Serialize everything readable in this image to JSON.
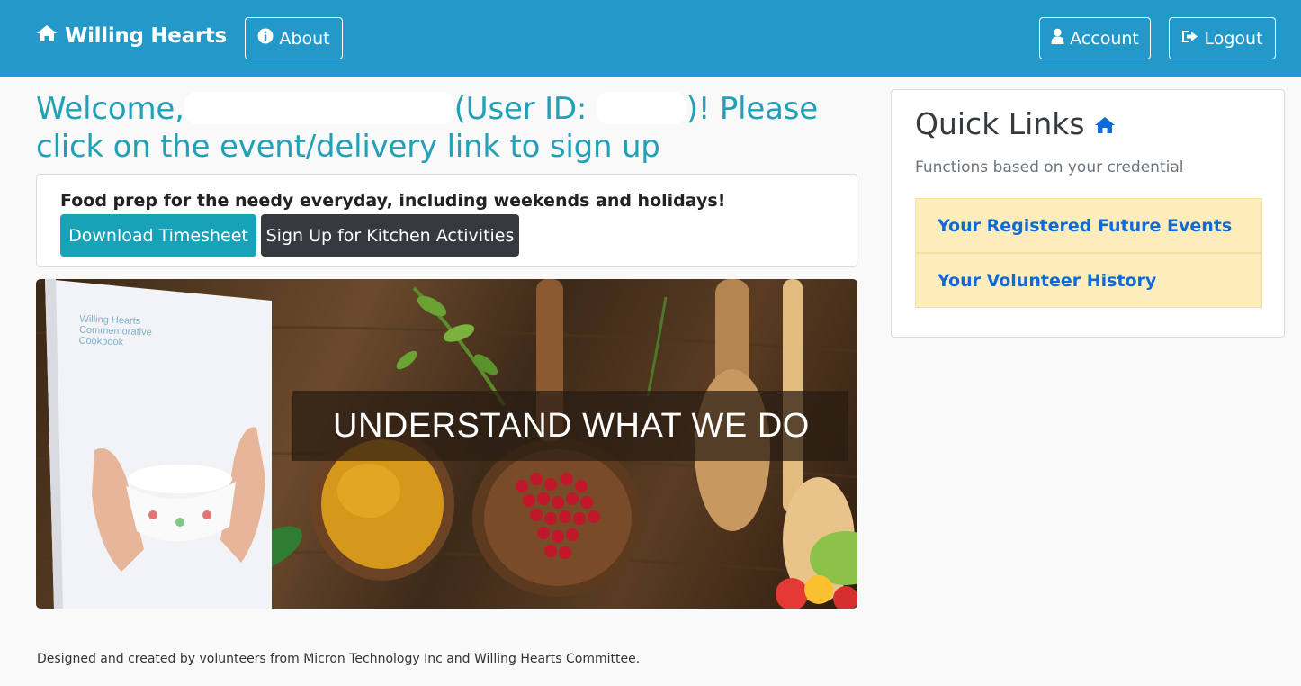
{
  "navbar": {
    "brand": "Willing Hearts",
    "about": "About",
    "account": "Account",
    "logout": "Logout",
    "colors": {
      "background": "#2399c9",
      "text": "#ffffff"
    }
  },
  "welcome": {
    "prefix": "Welcome,",
    "user_id_prefix": "(User ID:",
    "suffix": ")! Please click on the event/delivery link to sign up"
  },
  "event": {
    "title": "Food prep for the needy everyday, including weekends and holidays!",
    "download_label": "Download Timesheet",
    "signup_label": "Sign Up for Kitchen Activities"
  },
  "banner": {
    "caption": "UNDERSTAND WHAT WE DO",
    "book_title": "Willing Hearts\nCommemorative\nCookbook"
  },
  "quick_links": {
    "title": "Quick Links",
    "subtitle": "Functions based on your credential",
    "items": [
      {
        "label": "Your Registered Future Events"
      },
      {
        "label": "Your Volunteer History"
      }
    ]
  },
  "footer": {
    "text": "Designed and created by volunteers from Micron Technology Inc and Willing Hearts Committee."
  },
  "icons": {
    "brand": "home-icon",
    "about": "info-circle-icon",
    "account": "user-icon",
    "logout": "sign-out-icon",
    "quick_links": "home-icon"
  }
}
